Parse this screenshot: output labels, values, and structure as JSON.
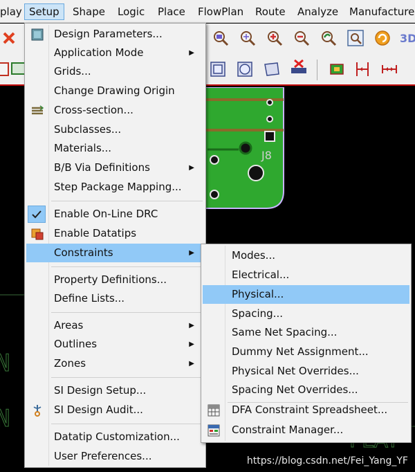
{
  "menubar": {
    "items": [
      {
        "label": "play"
      },
      {
        "label": "Setup"
      },
      {
        "label": "Shape"
      },
      {
        "label": "Logic"
      },
      {
        "label": "Place"
      },
      {
        "label": "FlowPlan"
      },
      {
        "label": "Route"
      },
      {
        "label": "Analyze"
      },
      {
        "label": "Manufacture"
      }
    ],
    "active_index": 1
  },
  "canvas": {
    "silk_label": "J8",
    "letters": [
      "N",
      "N"
    ],
    "plate_text": "PLAT"
  },
  "setup_menu": {
    "items": [
      {
        "label": "Design Parameters...",
        "icon": "design-parameters-icon",
        "submenu": false
      },
      {
        "label": "Application Mode",
        "icon": "",
        "submenu": true
      },
      {
        "label": "Grids...",
        "icon": "",
        "submenu": false
      },
      {
        "label": "Change Drawing Origin",
        "icon": "",
        "submenu": false
      },
      {
        "label": "Cross-section...",
        "icon": "cross-section-icon",
        "submenu": false
      },
      {
        "label": "Subclasses...",
        "icon": "",
        "submenu": false
      },
      {
        "label": "Materials...",
        "icon": "",
        "submenu": false
      },
      {
        "label": "B/B Via Definitions",
        "icon": "",
        "submenu": true
      },
      {
        "label": "Step Package Mapping...",
        "icon": "",
        "submenu": false
      },
      {
        "label": "Enable On-Line DRC",
        "icon": "checkmark-icon",
        "checked": true,
        "submenu": false
      },
      {
        "label": "Enable Datatips",
        "icon": "datatips-icon",
        "submenu": false
      },
      {
        "label": "Constraints",
        "icon": "",
        "submenu": true,
        "highlighted": true
      },
      {
        "label": "Property Definitions...",
        "icon": "",
        "submenu": false
      },
      {
        "label": "Define Lists...",
        "icon": "",
        "submenu": false
      },
      {
        "label": "Areas",
        "icon": "",
        "submenu": true
      },
      {
        "label": "Outlines",
        "icon": "",
        "submenu": true
      },
      {
        "label": "Zones",
        "icon": "",
        "submenu": true
      },
      {
        "label": "SI Design Setup...",
        "icon": "",
        "submenu": false
      },
      {
        "label": "SI Design Audit...",
        "icon": "si-audit-icon",
        "submenu": false
      },
      {
        "label": "Datatip Customization...",
        "icon": "",
        "submenu": false
      },
      {
        "label": "User Preferences...",
        "icon": "",
        "submenu": false
      }
    ]
  },
  "constraints_menu": {
    "items": [
      {
        "label": "Modes...",
        "icon": ""
      },
      {
        "label": "Electrical...",
        "icon": ""
      },
      {
        "label": "Physical...",
        "icon": "",
        "highlighted": true
      },
      {
        "label": "Spacing...",
        "icon": ""
      },
      {
        "label": "Same Net Spacing...",
        "icon": ""
      },
      {
        "label": "Dummy Net Assignment...",
        "icon": ""
      },
      {
        "label": "Physical Net Overrides...",
        "icon": ""
      },
      {
        "label": "Spacing Net Overrides...",
        "icon": ""
      },
      {
        "label": "DFA Constraint Spreadsheet...",
        "icon": "spreadsheet-icon"
      },
      {
        "label": "Constraint Manager...",
        "icon": "constraint-manager-icon"
      }
    ]
  },
  "watermark": "https://blog.csdn.net/Fei_Yang_YF",
  "colors": {
    "highlight": "#91c9f7",
    "pcb_green": "#2fa82f",
    "board_outline": "#c8b4ff"
  }
}
